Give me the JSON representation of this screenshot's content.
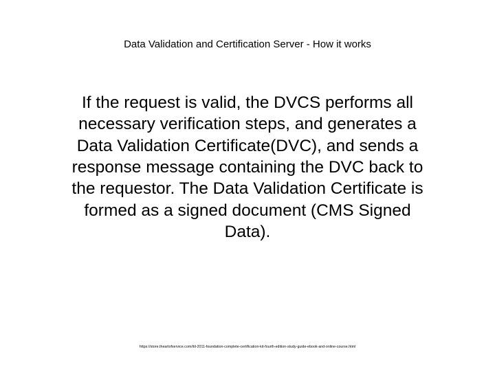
{
  "title": "Data Validation and Certification Server - How it works",
  "body": "If the request is valid, the DVCS performs all necessary verification steps, and generates a Data Validation Certificate(DVC), and sends a response message containing the DVC back to the requestor. The Data Validation Certificate is formed as a signed document (CMS Signed Data).",
  "footer": "https://store.theartofservice.com/itil-2011-foundation-complete-certification-kit-fourth-edition-study-guide-ebook-and-online-course.html"
}
